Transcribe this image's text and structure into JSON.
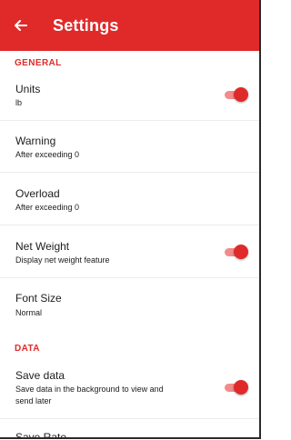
{
  "appbar": {
    "title": "Settings",
    "back_icon": "arrow-left-icon",
    "color": "#e02a2a"
  },
  "sections": {
    "general": "GENERAL",
    "data": "DATA"
  },
  "settings": {
    "units": {
      "title": "Units",
      "subtitle": "lb",
      "enabled": true
    },
    "warning": {
      "title": "Warning",
      "subtitle": "After exceeding 0"
    },
    "overload": {
      "title": "Overload",
      "subtitle": "After exceeding 0"
    },
    "net_weight": {
      "title": "Net Weight",
      "subtitle": "Display net weight feature",
      "enabled": true
    },
    "font_size": {
      "title": "Font Size",
      "subtitle": "Normal"
    },
    "save_data": {
      "title": "Save data",
      "subtitle_line1": "Save data in the background to view and",
      "subtitle_line2": "send later",
      "enabled": true
    },
    "save_rate": {
      "title": "Save Rate"
    }
  }
}
